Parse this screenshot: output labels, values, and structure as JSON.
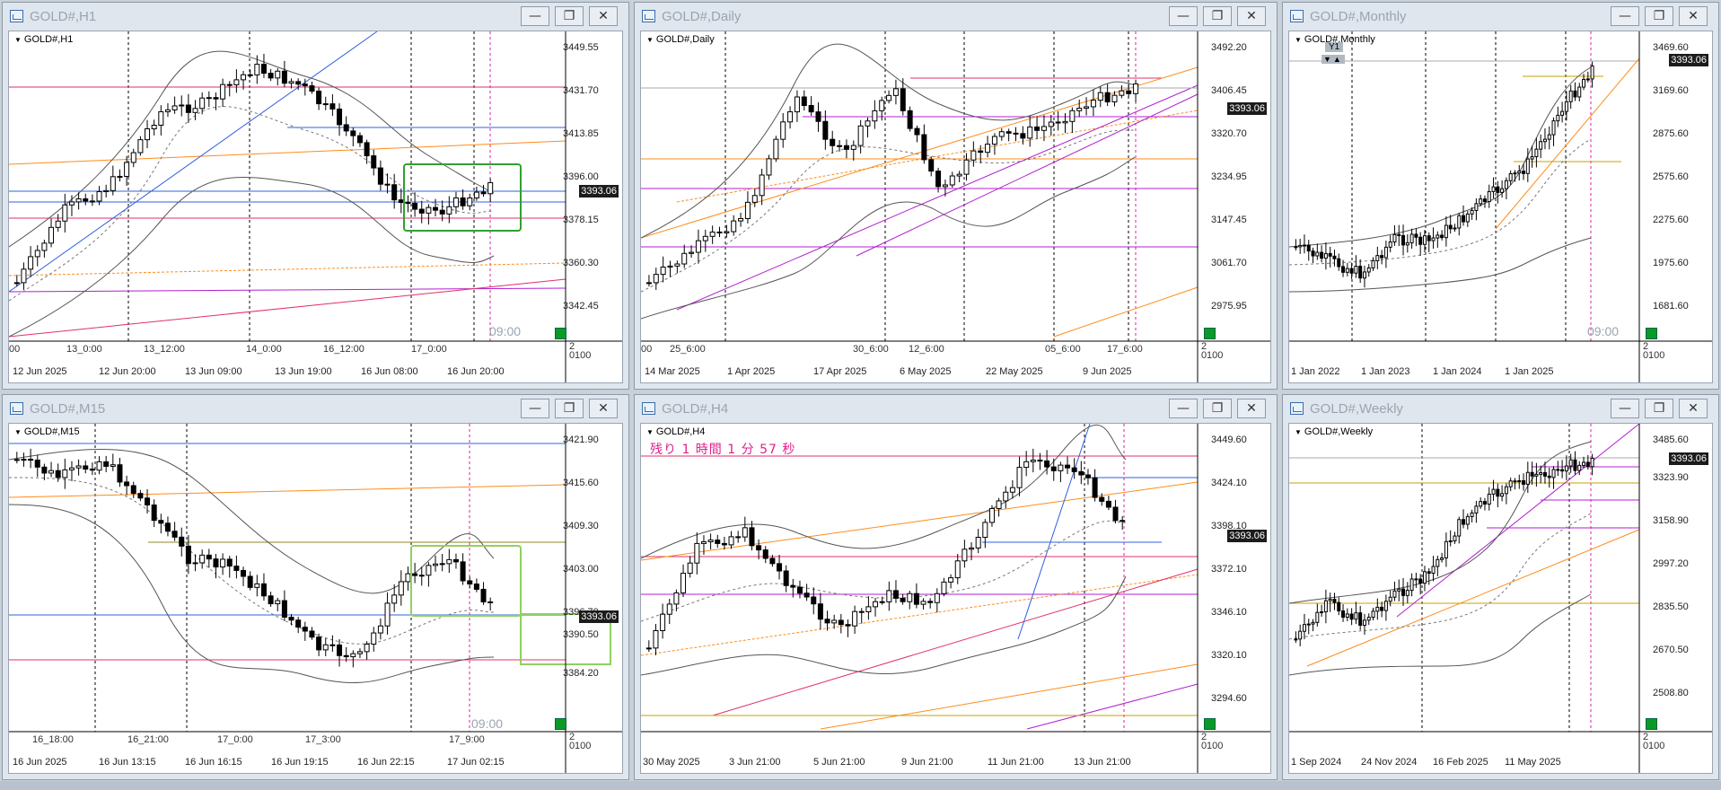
{
  "windows": [
    {
      "id": "h1",
      "title": "GOLD#,H1",
      "chart_label": "GOLD#,H1",
      "price_tag": "3393.06",
      "y_ticks": [
        "3449.55",
        "3431.70",
        "3413.85",
        "3396.00",
        "3378.15",
        "3360.30",
        "3342.45"
      ],
      "x_ticks_top": [
        "00",
        "13_0:00",
        "13_12:00",
        "14_0:00",
        "16_12:00",
        "17_0:00"
      ],
      "x_ticks_bottom": [
        "12 Jun 2025",
        "12 Jun 20:00",
        "13 Jun 09:00",
        "13 Jun 19:00",
        "16 Jun 08:00",
        "16 Jun 20:00"
      ],
      "subpanel_ticks": [
        "2",
        "0",
        "100"
      ],
      "timer": "09:00"
    },
    {
      "id": "daily",
      "title": "GOLD#,Daily",
      "chart_label": "GOLD#,Daily",
      "price_tag": "3393.06",
      "y_ticks": [
        "3492.20",
        "3406.45",
        "3320.70",
        "3234.95",
        "3147.45",
        "3061.70",
        "2975.95"
      ],
      "x_ticks_top": [
        "00",
        "25_6:00",
        "30_6:00",
        "12_6:00",
        "05_6:00",
        "17_6:00"
      ],
      "x_ticks_bottom": [
        "14 Mar 2025",
        "1 Apr 2025",
        "17 Apr 2025",
        "6 May 2025",
        "22 May 2025",
        "9 Jun 2025"
      ],
      "subpanel_ticks": [
        "2",
        "0",
        "100"
      ]
    },
    {
      "id": "monthly",
      "title": "GOLD#,Monthly",
      "chart_label": "GOLD#,Monthly",
      "price_tag": "3393.06",
      "y_ticks": [
        "3469.60",
        "3169.60",
        "2875.60",
        "2575.60",
        "2275.60",
        "1975.60",
        "1681.60"
      ],
      "x_ticks_bottom": [
        "1 Jan 2022",
        "1 Jan 2023",
        "1 Jan 2024",
        "1 Jan 2025"
      ],
      "subpanel_ticks": [
        "2",
        "0",
        "100"
      ],
      "badge_top": "Y1",
      "badge_arrows": "▼▲",
      "timer": "09:00"
    },
    {
      "id": "m15",
      "title": "GOLD#,M15",
      "chart_label": "GOLD#,M15",
      "price_tag": "3393.06",
      "y_ticks": [
        "3421.90",
        "3415.60",
        "3409.30",
        "3403.00",
        "3396.70",
        "3390.50",
        "3384.20"
      ],
      "x_ticks_top": [
        "16_18:00",
        "16_21:00",
        "17_0:00",
        "17_3:00",
        "17_9:00"
      ],
      "x_ticks_bottom": [
        "16 Jun 2025",
        "16 Jun 13:15",
        "16 Jun 16:15",
        "16 Jun 19:15",
        "16 Jun 22:15",
        "17 Jun 02:15"
      ],
      "subpanel_ticks": [
        "2",
        "0",
        "100"
      ],
      "timer": "09:00"
    },
    {
      "id": "h4",
      "title": "GOLD#,H4",
      "chart_label": "GOLD#,H4",
      "price_tag": "3393.06",
      "y_ticks": [
        "3449.60",
        "3424.10",
        "3398.10",
        "3372.10",
        "3346.10",
        "3320.10",
        "3294.60"
      ],
      "x_ticks_bottom": [
        "30 May 2025",
        "3 Jun 21:00",
        "5 Jun 21:00",
        "9 Jun 21:00",
        "11 Jun 21:00",
        "13 Jun 21:00"
      ],
      "subpanel_ticks": [
        "2",
        "0",
        "100"
      ],
      "countdown": "残り 1 時間 1 分 57 秒"
    },
    {
      "id": "weekly",
      "title": "GOLD#,Weekly",
      "chart_label": "GOLD#,Weekly",
      "price_tag": "3393.06",
      "y_ticks": [
        "3485.60",
        "3323.90",
        "3158.90",
        "2997.20",
        "2835.50",
        "2670.50",
        "2508.80"
      ],
      "x_ticks_bottom": [
        "1 Sep 2024",
        "24 Nov 2024",
        "16 Feb 2025",
        "11 May 2025"
      ],
      "subpanel_ticks": [
        "2",
        "0",
        "100"
      ]
    }
  ],
  "window_buttons": {
    "minimize": "—",
    "restore": "❐",
    "close": "✕"
  },
  "colors": {
    "bull": "#ffffff",
    "bear": "#000000",
    "resistance": "#e0306a",
    "trend_orange": "#ff8c1a",
    "trend_purple": "#b020d0",
    "trend_blue": "#3060e0",
    "box_green": "#30a030"
  }
}
